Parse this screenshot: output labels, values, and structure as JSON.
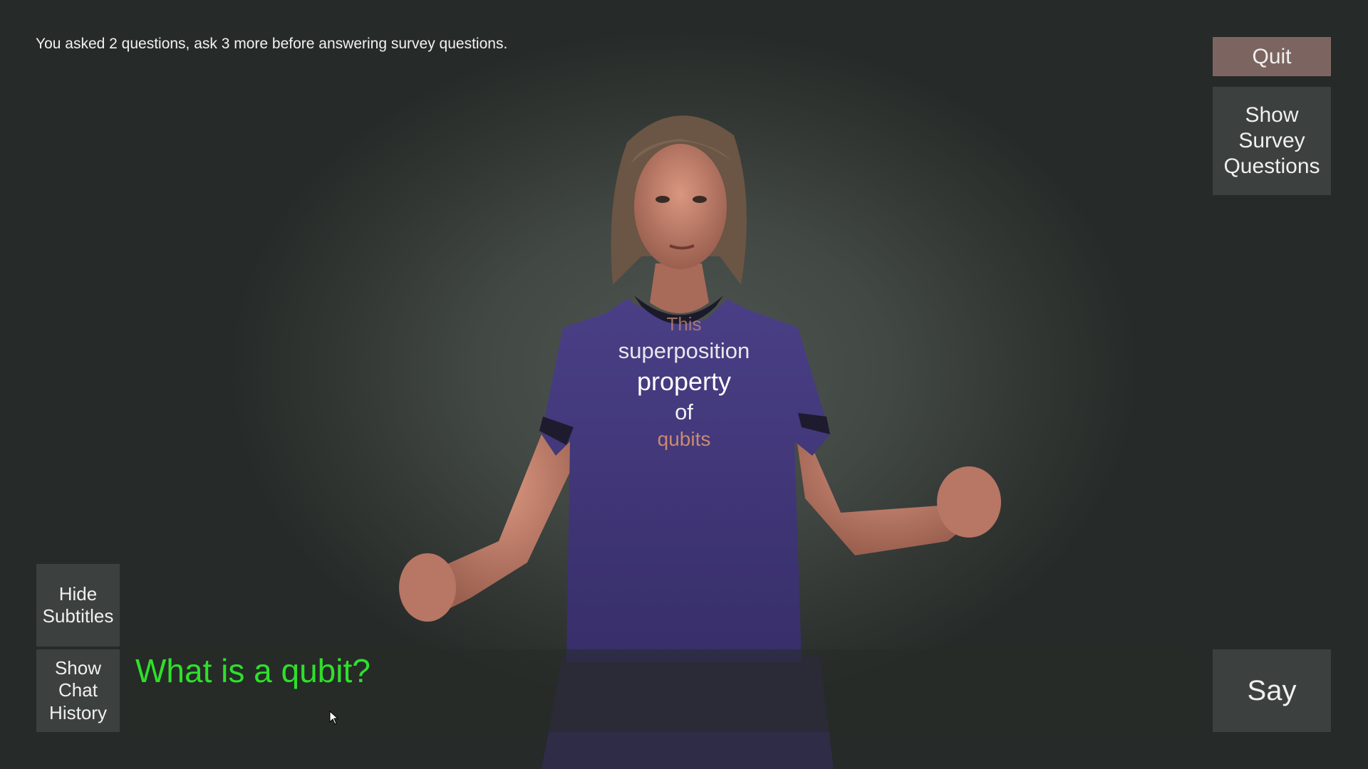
{
  "status_text": "You asked 2 questions, ask 3 more before answering survey questions.",
  "buttons": {
    "quit": "Quit",
    "show_survey": "Show Survey Questions",
    "hide_subtitles": "Hide Subtitles",
    "show_chat_history": "Show Chat History",
    "say": "Say"
  },
  "chat_input": {
    "value": "What is a qubit?"
  },
  "subtitles": {
    "words": [
      "This",
      "superposition",
      "property",
      "of",
      "qubits"
    ]
  },
  "colors": {
    "input_text": "#2fe02a",
    "quit_button": "#7c6560",
    "shirt": "#3f3576",
    "skin": "#b0705d"
  }
}
